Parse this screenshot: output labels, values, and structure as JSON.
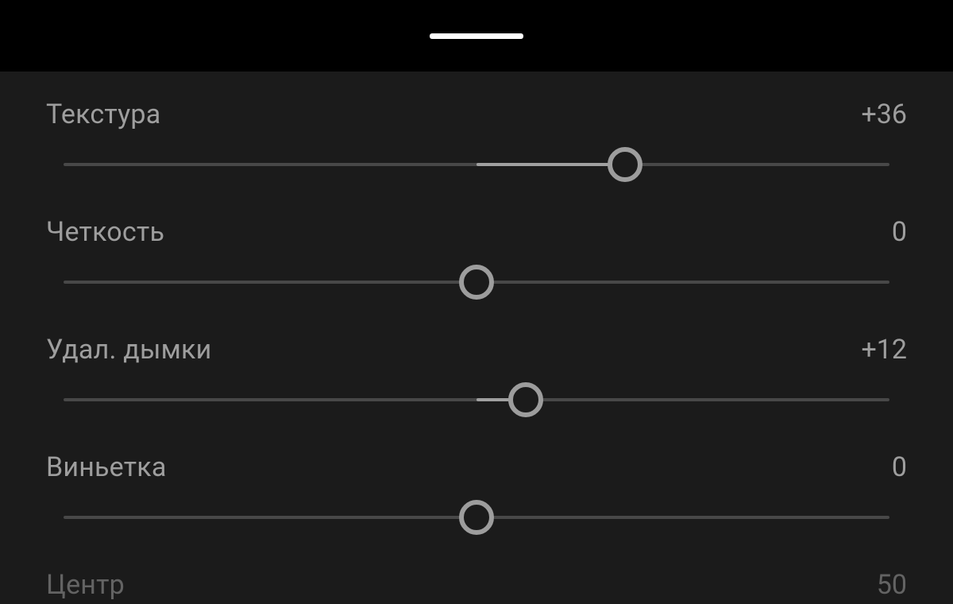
{
  "sliders": [
    {
      "label": "Текстура",
      "value": 36,
      "display": "+36",
      "min": -100,
      "max": 100
    },
    {
      "label": "Четкость",
      "value": 0,
      "display": "0",
      "min": -100,
      "max": 100
    },
    {
      "label": "Удал. дымки",
      "value": 12,
      "display": "+12",
      "min": -100,
      "max": 100
    },
    {
      "label": "Виньетка",
      "value": 0,
      "display": "0",
      "min": -100,
      "max": 100
    }
  ],
  "partial": {
    "label": "Центр",
    "display": "50"
  },
  "colors": {
    "bg": "#1b1b1b",
    "track_inactive": "#484848",
    "track_active": "#a0a0a0",
    "text": "#9e9e9e",
    "handle_border": "#9d9d9d"
  }
}
